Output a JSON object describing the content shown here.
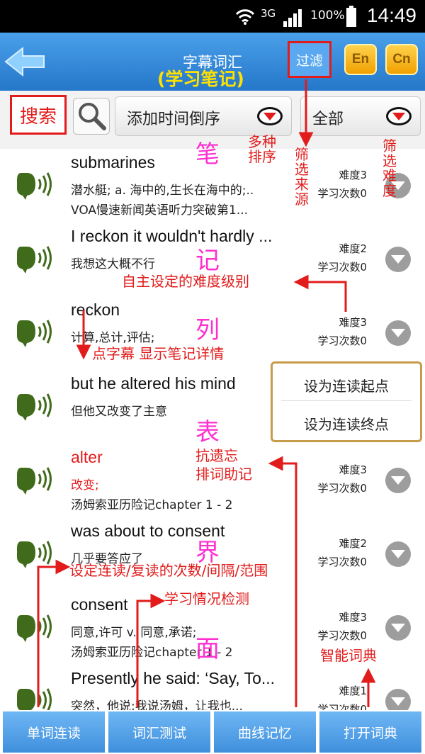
{
  "status": {
    "network": "3G",
    "battery": "100%",
    "time": "14:49"
  },
  "header": {
    "title": "字幕词汇",
    "filter_button": "过滤",
    "en_button": "En",
    "cn_button": "Cn",
    "subtitle_note": "(学习笔记)"
  },
  "toolbar": {
    "search_label": "搜索",
    "sort_select": "添加时间倒序",
    "scope_select": "全部"
  },
  "rows": [
    {
      "word": "submarines",
      "meaning": "潜水艇; a. 海中的,生长在海中的;..",
      "source": "VOA慢速新闻英语听力突破第1...",
      "difficulty": "难度3",
      "count": "学习次数0"
    },
    {
      "word": "I reckon it wouldn't hardly ...",
      "meaning": "我想这大概不行",
      "source": "",
      "difficulty": "难度2",
      "count": "学习次数0"
    },
    {
      "word": "reckon",
      "meaning": "计算,总计,评估;",
      "source": "",
      "difficulty": "难度3",
      "count": "学习次数0"
    },
    {
      "word": "but he altered his mind",
      "meaning": "但他又改变了主意",
      "source": "",
      "difficulty": "",
      "count": ""
    },
    {
      "word": "alter",
      "meaning": "改变;",
      "source": "汤姆索亚历险记chapter 1 - 2",
      "difficulty": "难度3",
      "count": "学习次数0"
    },
    {
      "word": "was about to consent",
      "meaning": "几乎要答应了",
      "source": "",
      "difficulty": "难度2",
      "count": "学习次数0"
    },
    {
      "word": "consent",
      "meaning": "同意,许可 v. 同意,承诺;",
      "source": "汤姆索亚历险记chapter 1 - 2",
      "difficulty": "难度3",
      "count": "学习次数0"
    },
    {
      "word": "Presently he said: ‘Say, To...",
      "meaning": "突然，他说:我说汤姆，让我也...",
      "source": "",
      "difficulty": "难度1",
      "count": "学习次数0"
    }
  ],
  "popup": {
    "start": "设为连读起点",
    "end": "设为连读终点"
  },
  "tabs": {
    "t1": "单词连读",
    "t2": "词汇测试",
    "t3": "曲线记忆",
    "t4": "打开词典"
  },
  "annotations": {
    "sort_note": "多种排序",
    "source_note": "筛选来源",
    "difficulty_note": "筛选难度",
    "level_note": "自主设定的难度级别",
    "detail_note": "点字幕  显示笔记详情",
    "memory_note_1": "抗遗忘",
    "memory_note_2": "排词助记",
    "repeat_note": "设定连读/复读的次数/间隔/范围",
    "test_note": "学习情况检测",
    "dict_note": "智能词典",
    "list_caption": [
      "笔",
      "记",
      "列",
      "表",
      "界",
      "面"
    ]
  },
  "colors": {
    "header_blue": "#2f86d8",
    "annotation_red": "#e21b1b",
    "caption_magenta": "#ff2fd0",
    "speaker_green": "#3f6b1a"
  }
}
